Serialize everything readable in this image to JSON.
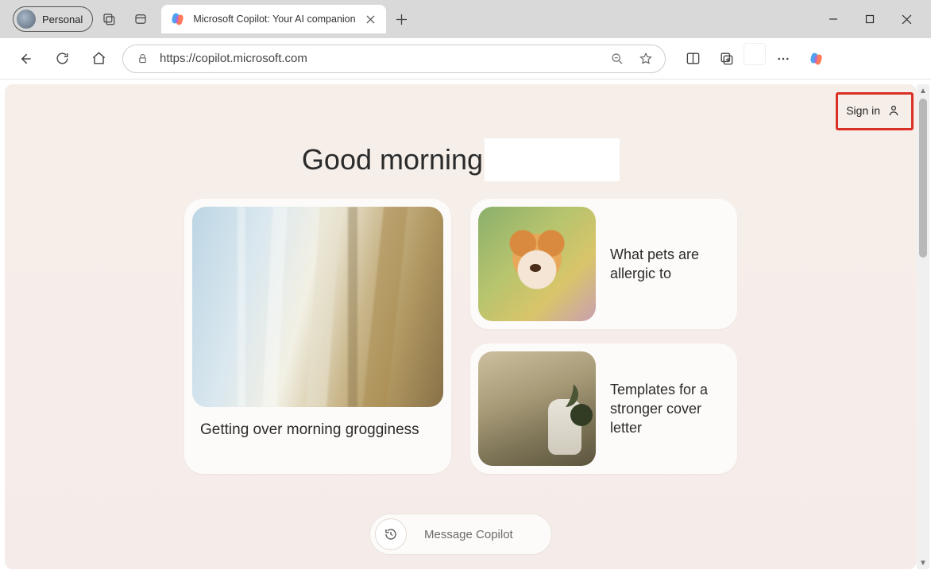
{
  "browser": {
    "profile_label": "Personal",
    "tab_title": "Microsoft Copilot: Your AI companion",
    "url": "https://copilot.microsoft.com"
  },
  "page": {
    "signin_label": "Sign in",
    "greeting": "Good morning",
    "cards": {
      "large": {
        "title": "Getting over morning grogginess"
      },
      "small1": {
        "title": "What pets are allergic to"
      },
      "small2": {
        "title": "Templates for a stronger cover letter"
      }
    },
    "message_placeholder": "Message Copilot"
  }
}
